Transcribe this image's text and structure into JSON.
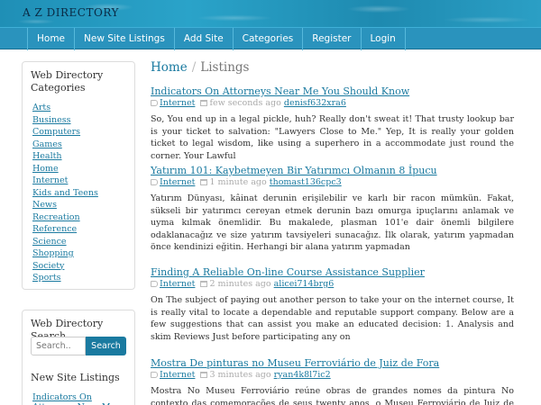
{
  "site": {
    "title": "A Z DIRECTORY"
  },
  "nav": {
    "items": [
      {
        "label": "Home"
      },
      {
        "label": "New Site Listings"
      },
      {
        "label": "Add Site"
      },
      {
        "label": "Categories"
      },
      {
        "label": "Register"
      },
      {
        "label": "Login"
      }
    ]
  },
  "sidebar": {
    "categories_heading": "Web Directory Categories",
    "categories": [
      {
        "label": "Arts"
      },
      {
        "label": "Business"
      },
      {
        "label": "Computers"
      },
      {
        "label": "Games"
      },
      {
        "label": "Health"
      },
      {
        "label": "Home"
      },
      {
        "label": "Internet"
      },
      {
        "label": "Kids and Teens"
      },
      {
        "label": "News"
      },
      {
        "label": "Recreation"
      },
      {
        "label": "Reference"
      },
      {
        "label": "Science"
      },
      {
        "label": "Shopping"
      },
      {
        "label": "Society"
      },
      {
        "label": "Sports"
      }
    ],
    "search_heading": "Web Directory Search",
    "search_placeholder": "Search..",
    "search_button": "Search",
    "new_listings_heading": "New Site Listings",
    "new_listing_first": "Indicators On Attorneys Near Me"
  },
  "breadcrumb": {
    "home": "Home",
    "separator": "/",
    "current": "Listings"
  },
  "listings": [
    {
      "title": "Indicators On Attorneys Near Me You Should Know",
      "category": "Internet",
      "time": "few seconds ago",
      "user": "denisf632xra6",
      "description": "So, You end up in a legal pickle, huh? Really don't sweat it! That trusty lookup bar is your ticket to salvation: \"Lawyers Close to Me.\" Yep, It is really your golden ticket to legal wisdom, like using a superhero in a accommodate just round the corner. Your Lawful"
    },
    {
      "title": "Yatırım 101: Kaybetmeyen Bir Yatırımcı Olmanın 8 İpucu",
      "category": "Internet",
      "time": "1 minute ago",
      "user": "thomast136cpc3",
      "description": "Yatırım Dünyası, kâinat derunin erişilebilir ve karlı bir racon mümkün. Fakat, sükseli bir yatırımcı cereyan etmek derunin bazı omurga ipuçlarını anlamak ve uyma kılmak önemlidir. Bu makalede, plasman 101'e dair önemli bilgilere odaklanacağız ve size yatırım tavsiyeleri sunacağız. İlk olarak, yatırım yapmadan önce kendinizi eğitin. Herhangi bir alana yatırım yapmadan"
    },
    {
      "title": "Finding A Reliable On-line Course Assistance Supplier",
      "category": "Internet",
      "time": "2 minutes ago",
      "user": "alicei714brg6",
      "description": "On The subject of paying out another person to take your on the internet course, It is really vital to locate a dependable and reputable support company. Below are a few suggestions that can assist you make an educated decision: 1. Analysis and skim Reviews Just before participating any on"
    },
    {
      "title": "Mostra De pinturas no Museu Ferroviário de Juiz de Fora",
      "category": "Internet",
      "time": "3 minutes ago",
      "user": "ryan4k8l7ic2",
      "description": "Mostra No Museu Ferroviário reúne obras de grandes nomes da pintura No contexto das comemorações de seus twenty anos, o Museu Ferroviário de Juiz de Fora, localizado na"
    }
  ]
}
